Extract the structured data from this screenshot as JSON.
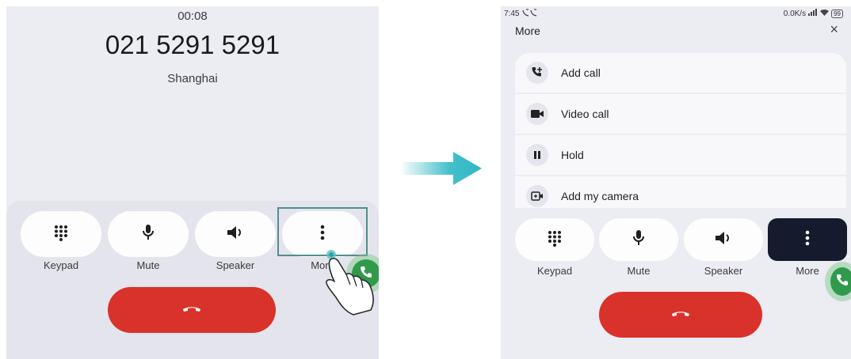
{
  "left_phone": {
    "timer": "00:08",
    "number": "021 5291 5291",
    "location": "Shanghai",
    "controls": [
      {
        "label": "Keypad",
        "icon": "keypad-icon"
      },
      {
        "label": "Mute",
        "icon": "mic-icon"
      },
      {
        "label": "Speaker",
        "icon": "speaker-icon"
      },
      {
        "label": "More",
        "icon": "more-vert-icon"
      }
    ],
    "hangup_icon": "end-call-icon"
  },
  "right_phone": {
    "status": {
      "time": "7:45",
      "speed": "0.0K/s",
      "battery": "99"
    },
    "sheet_title": "More",
    "close_glyph": "×",
    "menu": [
      {
        "label": "Add call",
        "icon": "add-call-icon"
      },
      {
        "label": "Video call",
        "icon": "video-call-icon"
      },
      {
        "label": "Hold",
        "icon": "pause-icon"
      },
      {
        "label": "Add my camera",
        "icon": "add-camera-icon"
      }
    ],
    "controls": [
      {
        "label": "Keypad",
        "icon": "keypad-icon"
      },
      {
        "label": "Mute",
        "icon": "mic-icon"
      },
      {
        "label": "Speaker",
        "icon": "speaker-icon"
      },
      {
        "label": "More",
        "icon": "more-vert-icon",
        "active": true
      }
    ],
    "hangup_icon": "end-call-icon"
  },
  "colors": {
    "hangup": "#d9322a",
    "arrow": "#2fb8c4",
    "active_button": "#151b2c",
    "fab": "#2f9a4b",
    "highlight_box": "#4f8f8c"
  }
}
